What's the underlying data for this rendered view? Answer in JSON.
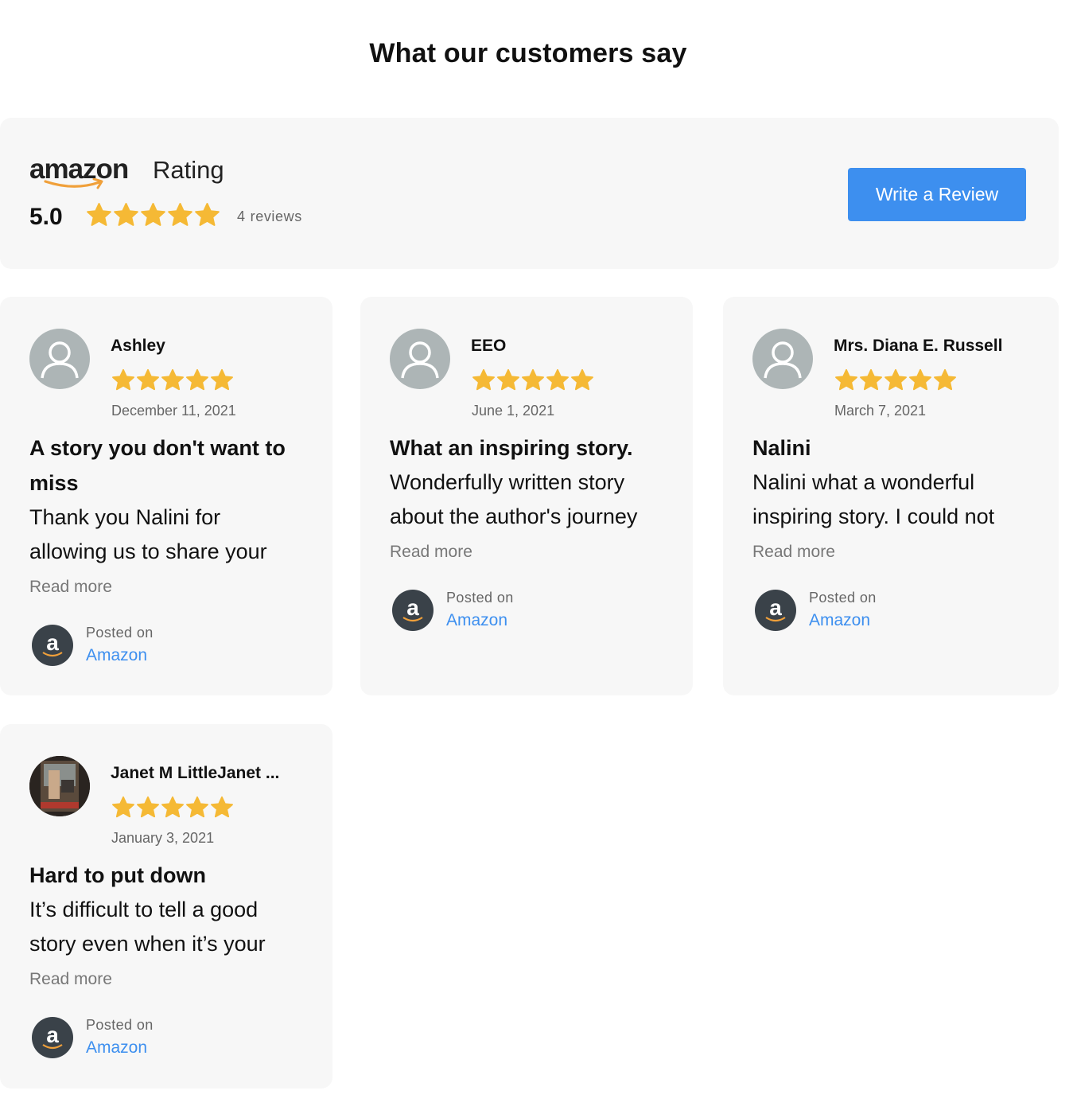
{
  "header": {
    "title": "What our customers say"
  },
  "summary": {
    "logo_text": "amazon",
    "rating_label": "Rating",
    "average": "5.0",
    "stars": 5,
    "review_count": "4",
    "reviews_word": "reviews",
    "write_review_label": "Write a Review"
  },
  "colors": {
    "star": "#f5b935",
    "button": "#3d8fef",
    "link": "#3d8fef",
    "card_bg": "#f7f7f7"
  },
  "reviews": [
    {
      "author": "Ashley",
      "stars": 5,
      "date": "December 11, 2021",
      "title": "A story you don't want to miss",
      "text": "Thank you Nalini for allowing us to share your",
      "read_more": "Read more",
      "posted_on": "Posted on",
      "platform": "Amazon",
      "avatar_icon": "user-placeholder-icon"
    },
    {
      "author": "EEO",
      "stars": 5,
      "date": "June 1, 2021",
      "title": "What an inspiring story.",
      "text": "Wonderfully written story about the author's journey",
      "read_more": "Read more",
      "posted_on": "Posted on",
      "platform": "Amazon",
      "avatar_icon": "user-placeholder-icon"
    },
    {
      "author": "Mrs. Diana E. Russell",
      "stars": 5,
      "date": "March 7, 2021",
      "title": "Nalini",
      "text": "Nalini what a wonderful inspiring story. I could not",
      "read_more": "Read more",
      "posted_on": "Posted on",
      "platform": "Amazon",
      "avatar_icon": "user-placeholder-icon"
    },
    {
      "author": "Janet M LittleJanet ...",
      "stars": 5,
      "date": "January 3, 2021",
      "title": "Hard to put down",
      "text": "It’s difficult to tell a good story even when it’s your",
      "read_more": "Read more",
      "posted_on": "Posted on",
      "platform": "Amazon",
      "avatar_icon": "book-cover-avatar"
    }
  ]
}
